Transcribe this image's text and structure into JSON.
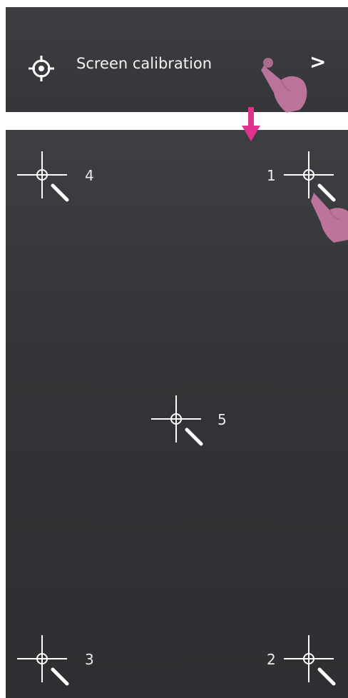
{
  "menu": {
    "label": "Screen calibration",
    "icon": "crosshair-target-icon",
    "chevron": ">"
  },
  "targets": [
    {
      "label": "4"
    },
    {
      "label": "1"
    },
    {
      "label": "5"
    },
    {
      "label": "3"
    },
    {
      "label": "2"
    }
  ],
  "colors": {
    "panel": "#3a3b3e",
    "text": "#f0f0f0",
    "accent": "#e0328e",
    "finger": "#c878a4"
  }
}
